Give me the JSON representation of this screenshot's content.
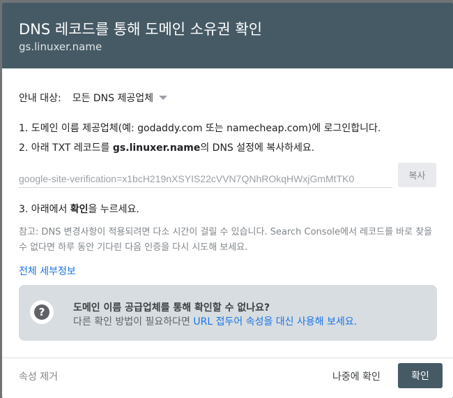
{
  "header": {
    "title": "DNS 레코드를 통해 도메인 소유권 확인",
    "subtitle": "gs.linuxer.name"
  },
  "target": {
    "label": "안내 대상:",
    "selected": "모든 DNS 제공업체"
  },
  "steps": {
    "step1": "1. 도메인 이름 제공업체(예: godaddy.com 또는 namecheap.com)에 로그인합니다.",
    "step2_prefix": "2. 아래 TXT 레코드를 ",
    "step2_domain": "gs.linuxer.name",
    "step2_suffix": "의 DNS 설정에 복사하세요.",
    "step3_prefix": "3. 아래에서 ",
    "step3_bold": "확인",
    "step3_suffix": "을 누르세요."
  },
  "txt_record": {
    "value": "google-site-verification=x1bcH219nXSYIS22cVVN7QNhROkqHWxjGmMtTK0",
    "copy_label": "복사"
  },
  "note": "참고: DNS 변경사항이 적용되려면 다소 시간이 걸릴 수 있습니다. Search Console에서 레코드를 바로 찾을 수 없다면 하루 동안 기다린 다음 인증을 다시 시도해 보세요.",
  "details_link": "전체 세부정보",
  "help": {
    "title": "도메인 이름 공급업체를 통해 확인할 수 없나요?",
    "body_prefix": "다른 확인 방법이 필요하다면 ",
    "body_link": "URL 접두어 속성을 대신 사용해 보세요."
  },
  "footer": {
    "remove": "속성 제거",
    "later": "나중에 확인",
    "confirm": "확인"
  },
  "colors": {
    "header_bg": "#465a65",
    "link": "#1a73e8",
    "help_bg": "#d7dde0"
  }
}
